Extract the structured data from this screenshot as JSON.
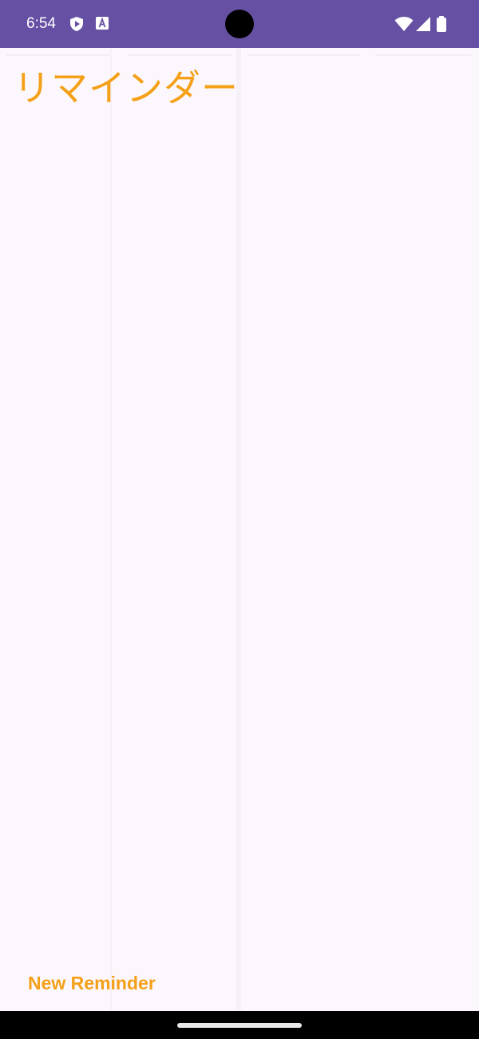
{
  "status_bar": {
    "time": "6:54",
    "left_icons": [
      "play-shield-icon",
      "keyboard-a-icon"
    ],
    "right_icons": [
      "wifi-icon",
      "cell-signal-icon",
      "battery-icon"
    ],
    "background_color": "#6650A4"
  },
  "main": {
    "title": "リマインダー",
    "new_reminder_label": "New Reminder",
    "accent_color": "#F4A018",
    "background_color": "#FCF7FC"
  },
  "nav_bar": {
    "home_indicator": "home-indicator"
  }
}
